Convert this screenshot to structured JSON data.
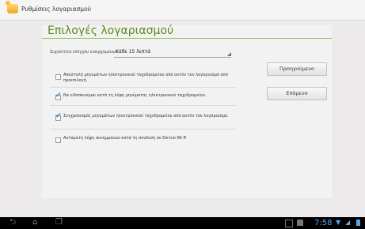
{
  "titlebar": {
    "title": "Ρυθμίσεις λογαριασμού",
    "icon": "settings-app-icon"
  },
  "page": {
    "heading": "Επιλογές λογαριασμού"
  },
  "frequency": {
    "label": "Συχνότητα ελέγχου εισερχομένων",
    "value": "Κάθε 15 λεπτά"
  },
  "options": [
    {
      "text": "Αποστολή μηνυμάτων ηλεκτρονικού ταχυδρομείου από αυτόν τον λογαριασμό από προεπιλογή.",
      "checked": false
    },
    {
      "text": "Να ειδοποιούμαι κατά τη λήψη μηνύματος ηλεκτρονικού ταχυδρομείου.",
      "checked": true
    },
    {
      "text": "Συγχρονισμός μηνυμάτων ηλεκτρονικού ταχυδρομείου από αυτόν τον λογαριασμό.",
      "checked": true
    },
    {
      "text": "Αυτόματη λήψη συνημμένων κατά τη σύνδεση σε δίκτυο Wi-Fi",
      "checked": false
    }
  ],
  "buttons": {
    "previous": "Προηγούμενο",
    "next": "Επόμενο"
  },
  "statusbar": {
    "time": "7:58",
    "icons": [
      "back-icon",
      "home-icon",
      "recent-apps-icon",
      "screenshot-icon",
      "gallery-icon",
      "wifi-icon",
      "signal-icon",
      "battery-icon"
    ]
  },
  "colors": {
    "accent": "#5d8a1a",
    "check": "#2f7fd4",
    "clock": "#5aa7e6"
  }
}
